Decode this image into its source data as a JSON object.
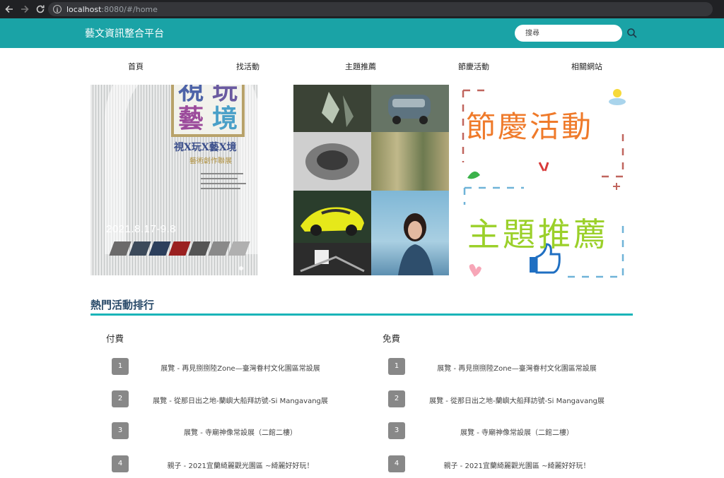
{
  "browser": {
    "url_host": "localhost",
    "url_path": ":8080/#/home"
  },
  "header": {
    "title": "藝文資訊整合平台",
    "search_placeholder": "搜尋"
  },
  "nav": {
    "items": [
      {
        "label": "首頁"
      },
      {
        "label": "找活動"
      },
      {
        "label": "主題推薦"
      },
      {
        "label": "節慶活動"
      },
      {
        "label": "相關網站"
      }
    ]
  },
  "banners": {
    "left": {
      "title_glyphs": [
        "視",
        "玩",
        "藝",
        "境"
      ],
      "subtitle": "視X玩X藝X境",
      "subtitle2": "藝術創作聯展",
      "date": "2021.8.17-9.8"
    },
    "right": {
      "line1": "節慶活動",
      "line2": "主題推薦"
    }
  },
  "ranking": {
    "title": "熱門活動排行",
    "paid": {
      "title": "付費",
      "items": [
        {
          "rank": "1",
          "text": "展覽 - 再見捌捌陸Zone—臺灣眷村文化園區常設展"
        },
        {
          "rank": "2",
          "text": "展覽 - 從那日出之地-蘭嶼大船拜訪號-Si Mangavang展"
        },
        {
          "rank": "3",
          "text": "展覽 - 寺廟神像常設展（二館二樓）"
        },
        {
          "rank": "4",
          "text": "親子 - 2021宜蘭綺麗觀光園區 ~綺麗好好玩！"
        }
      ]
    },
    "free": {
      "title": "免費",
      "items": [
        {
          "rank": "1",
          "text": "展覽 - 再見捌捌陸Zone—臺灣眷村文化園區常設展"
        },
        {
          "rank": "2",
          "text": "展覽 - 從那日出之地-蘭嶼大船拜訪號-Si Mangavang展"
        },
        {
          "rank": "3",
          "text": "展覽 - 寺廟神像常設展（二館二樓）"
        },
        {
          "rank": "4",
          "text": "親子 - 2021宜蘭綺麗觀光園區 ~綺麗好好玩！"
        }
      ]
    }
  },
  "colors": {
    "header_bg": "#1aa3a6",
    "accent_rule": "#1ab4b8",
    "rank_badge": "#888888"
  }
}
